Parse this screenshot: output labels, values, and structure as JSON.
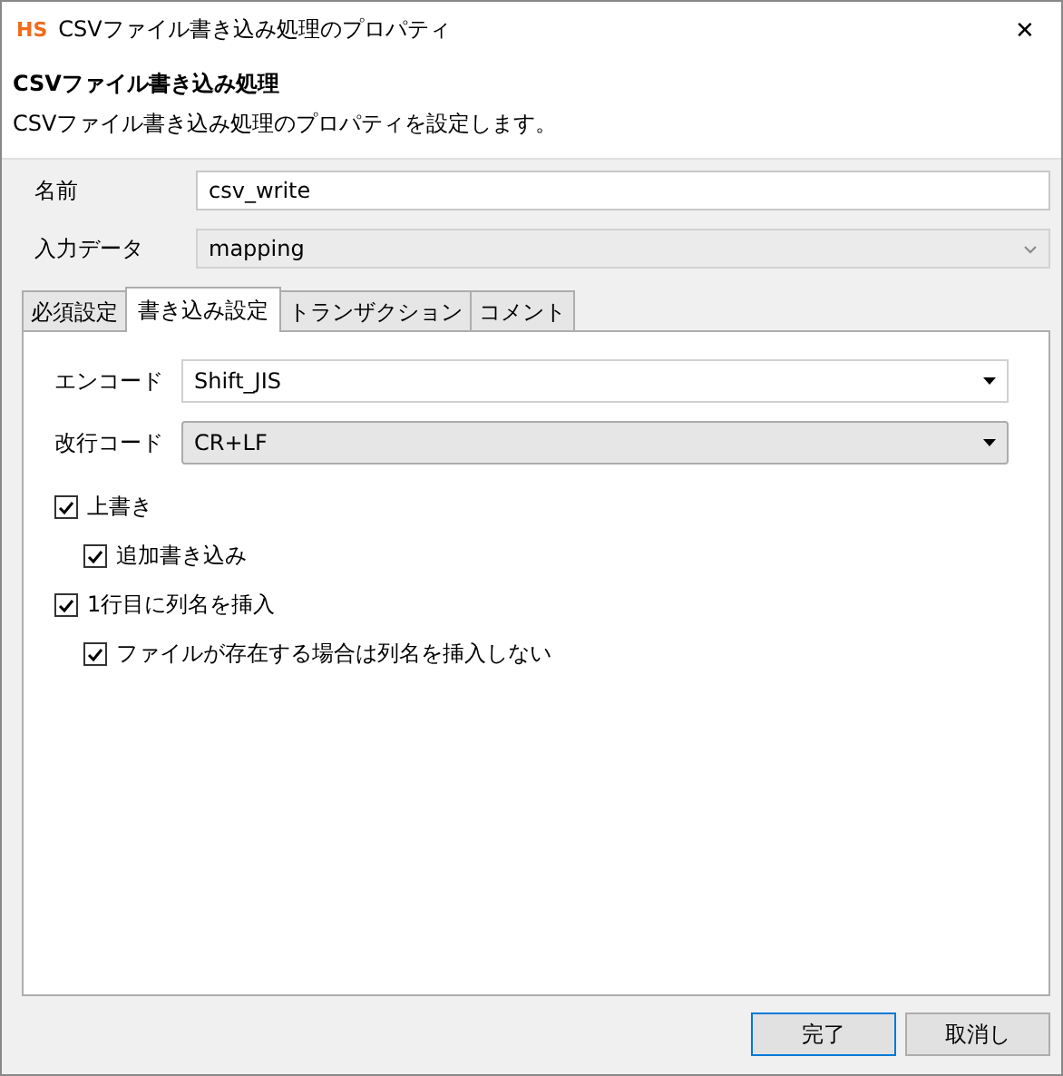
{
  "window": {
    "logo": "HS",
    "title": "CSVファイル書き込み処理のプロパティ",
    "close": "✕"
  },
  "header": {
    "title": "CSVファイル書き込み処理",
    "description": "CSVファイル書き込み処理のプロパティを設定します。"
  },
  "fields": [
    {
      "label": "名前",
      "kind": "text",
      "value": "csv_write"
    },
    {
      "label": "入力データ",
      "kind": "disabled-combo",
      "value": "mapping"
    }
  ],
  "tabs": [
    {
      "label": "必須設定",
      "selected": false
    },
    {
      "label": "書き込み設定",
      "selected": true
    },
    {
      "label": "トランザクション",
      "selected": false
    },
    {
      "label": "コメント",
      "selected": false
    }
  ],
  "settings": [
    {
      "label": "エンコード",
      "kind": "editable",
      "value": "Shift_JIS"
    },
    {
      "label": "改行コード",
      "kind": "readonly",
      "value": "CR+LF"
    }
  ],
  "options": [
    {
      "label": "上書き",
      "checked": true,
      "children": [
        {
          "label": "追加書き込み",
          "checked": true
        }
      ]
    },
    {
      "label": "1行目に列名を挿入",
      "checked": true,
      "children": [
        {
          "label": "ファイルが存在する場合は列名を挿入しない",
          "checked": true
        }
      ]
    }
  ],
  "buttons": [
    {
      "label": "完了",
      "default": true
    },
    {
      "label": "取消し",
      "default": false
    }
  ]
}
